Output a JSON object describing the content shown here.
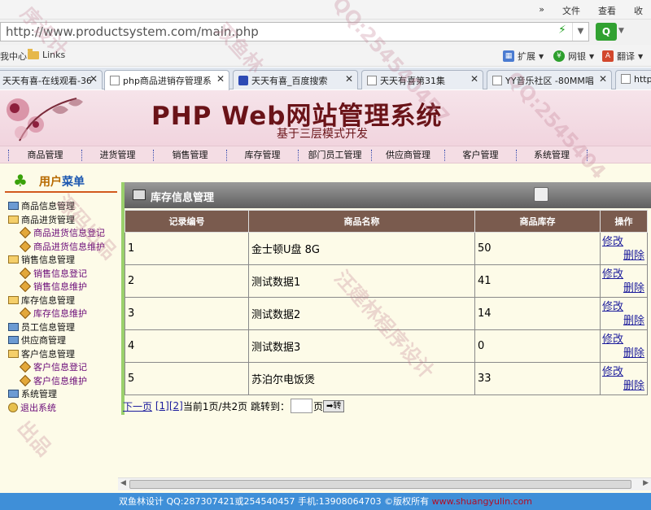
{
  "browser": {
    "menu": [
      "»",
      "文件",
      "查看",
      "收"
    ],
    "url": "http://www.productsystem.com/main.php",
    "favorites": [
      {
        "label": "我中心"
      },
      {
        "label": "Links"
      }
    ],
    "toolbar": [
      {
        "label": "扩展"
      },
      {
        "label": "网银"
      },
      {
        "label": "翻译"
      }
    ],
    "tabs": [
      {
        "label": "天天有喜-在线观看-36"
      },
      {
        "label": "php商品进销存管理系"
      },
      {
        "label": "天天有喜_百度搜索"
      },
      {
        "label": "天天有喜第31集"
      },
      {
        "label": "YY音乐社区 -80MM唱"
      },
      {
        "label": "http:"
      }
    ]
  },
  "banner": {
    "title": "PHP Web网站管理系统",
    "subtitle": "基于三层模式开发"
  },
  "nav": [
    "商品管理",
    "进货管理",
    "销售管理",
    "库存管理",
    "部门员工管理",
    "供应商管理",
    "客户管理",
    "系统管理"
  ],
  "sidebar": {
    "title_a": "用户",
    "title_b": "菜单",
    "items": [
      {
        "label": "商品信息管理",
        "kind": "book"
      },
      {
        "label": "商品进货管理",
        "kind": "folder"
      },
      {
        "label": "商品进货信息登记",
        "kind": "sub"
      },
      {
        "label": "商品进货信息维护",
        "kind": "sub"
      },
      {
        "label": "销售信息管理",
        "kind": "folder"
      },
      {
        "label": "销售信息登记",
        "kind": "sub"
      },
      {
        "label": "销售信息维护",
        "kind": "sub"
      },
      {
        "label": "库存信息管理",
        "kind": "folder"
      },
      {
        "label": "库存信息维护",
        "kind": "sub"
      },
      {
        "label": "员工信息管理",
        "kind": "book"
      },
      {
        "label": "供应商管理",
        "kind": "book"
      },
      {
        "label": "客户信息管理",
        "kind": "folder"
      },
      {
        "label": "客户信息登记",
        "kind": "sub"
      },
      {
        "label": "客户信息维护",
        "kind": "sub"
      },
      {
        "label": "系统管理",
        "kind": "book"
      },
      {
        "label": "退出系统",
        "kind": "exit"
      }
    ]
  },
  "main": {
    "title": "库存信息管理",
    "columns": [
      "记录编号",
      "商品名称",
      "商品库存",
      "操作"
    ],
    "rows": [
      {
        "id": "1",
        "name": "金士顿U盘 8G",
        "stock": "50"
      },
      {
        "id": "2",
        "name": "测试数据1",
        "stock": "41"
      },
      {
        "id": "3",
        "name": "测试数据2",
        "stock": "14"
      },
      {
        "id": "4",
        "name": "测试数据3",
        "stock": "0"
      },
      {
        "id": "5",
        "name": "苏泊尔电饭煲",
        "stock": "33"
      }
    ],
    "edit_label": "修改",
    "delete_label": "删除",
    "pager": {
      "next": "下一页",
      "pages": [
        "[1]",
        "[2]"
      ],
      "status": "当前1页/共2页",
      "jump_label": "跳转到：",
      "page_unit": "页",
      "go": "➡转"
    }
  },
  "footer": {
    "text": "双鱼林设计 QQ:287307421或254540457 手机:13908064703 ©版权所有 ",
    "site": "www.shuangyulin.com"
  },
  "watermark": [
    "序设计",
    "双鱼林",
    "QQ:254540457",
    "源码出品",
    "汪建林程序设计",
    "出品",
    "QQ:2545404"
  ]
}
